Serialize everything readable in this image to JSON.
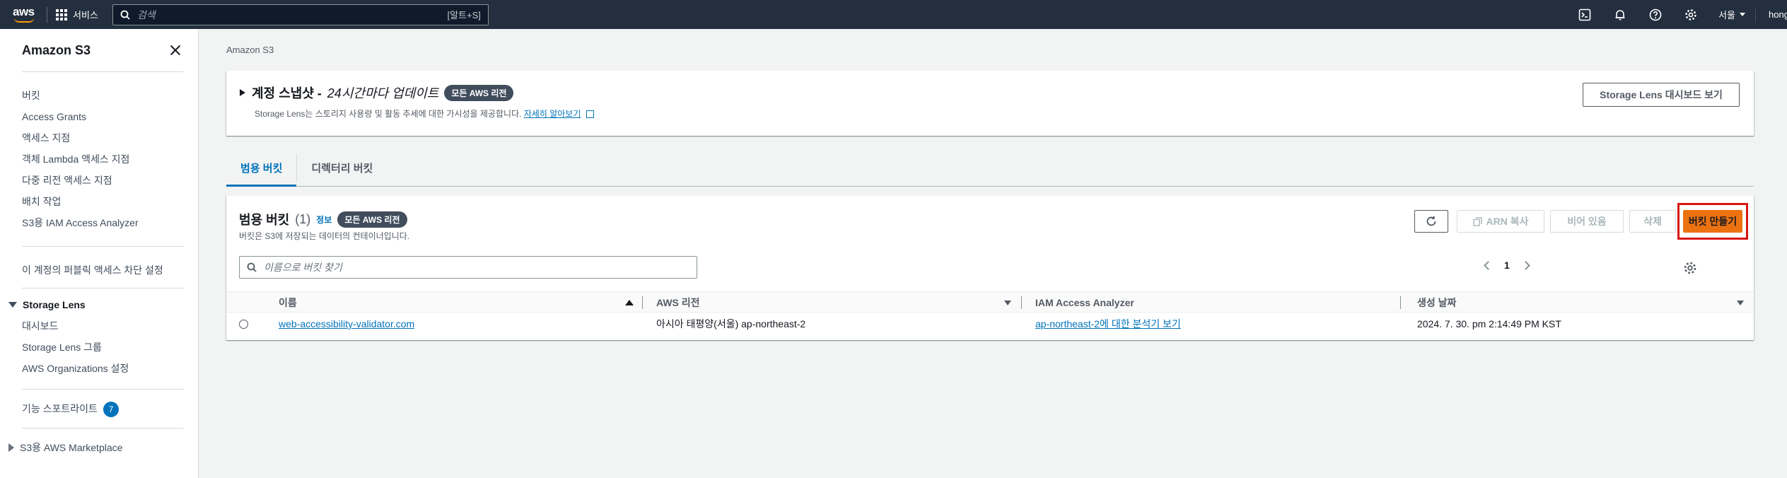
{
  "topnav": {
    "logo": "aws",
    "services_label": "서비스",
    "search_placeholder": "검색",
    "search_shortcut": "[알트+S]",
    "region": "서울",
    "account": "hongjun",
    "icons": [
      "cloudshell-icon",
      "bell-icon",
      "help-icon",
      "gear-icon"
    ]
  },
  "sidebar": {
    "title": "Amazon S3",
    "group1": [
      "버킷",
      "Access Grants",
      "액세스 지점",
      "객체 Lambda 액세스 지점",
      "다중 리전 액세스 지점",
      "배치 작업",
      "S3용 IAM Access Analyzer"
    ],
    "block_public": "이 계정의 퍼블릭 액세스 차단 설정",
    "storage_lens": {
      "label": "Storage Lens",
      "items": [
        "대시보드",
        "Storage Lens 그룹",
        "AWS Organizations 설정"
      ]
    },
    "feature_spotlight": "기능 스포트라이트",
    "feature_count": "7",
    "marketplace": "S3용 AWS Marketplace"
  },
  "main": {
    "breadcrumb": "Amazon S3",
    "snapshot": {
      "title": "계정 스냅샷 -",
      "subtitle": "24시간마다 업데이트",
      "pill": "모든 AWS 리전",
      "desc": "Storage Lens는 스토리지 사용량 및 활동 추세에 대한 가시성을 제공합니다.",
      "learn_more": "자세히 알아보기",
      "dashboard_button": "Storage Lens 대시보드 보기"
    },
    "tabs": [
      "범용 버킷",
      "디렉터리 버킷"
    ],
    "buckets": {
      "title": "범용 버킷",
      "count": "(1)",
      "info": "정보",
      "pill": "모든 AWS 리전",
      "desc": "버킷은 S3에 저장되는 데이터의 컨테이너입니다.",
      "btn_copy_arn": "ARN 복사",
      "btn_empty": "비어 있음",
      "btn_delete": "삭제",
      "btn_create": "버킷 만들기",
      "search_placeholder": "이름으로 버킷 찾기",
      "page": "1",
      "columns": [
        "이름",
        "AWS 리전",
        "IAM Access Analyzer",
        "생성 날짜"
      ],
      "rows": [
        {
          "name": "web-accessibility-validator.com",
          "region": "아시아 태평양(서울) ap-northeast-2",
          "analyzer": "ap-northeast-2에 대한 분석기 보기",
          "created": "2024. 7. 30. pm 2:14:49 PM KST"
        }
      ]
    }
  },
  "colors": {
    "nav_bg": "#232f3e",
    "accent_orange": "#ec7211",
    "link_blue": "#0073bb",
    "highlight_red": "#d91515"
  }
}
